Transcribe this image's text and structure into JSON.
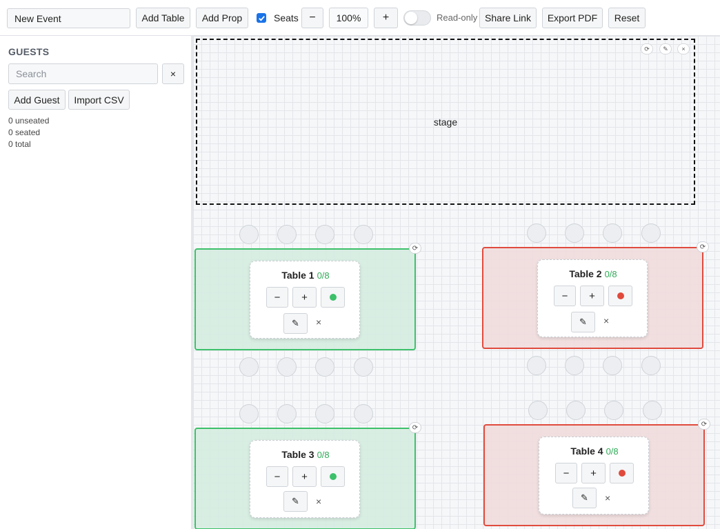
{
  "toolbar": {
    "event_name": "New Event",
    "add_table": "Add Table",
    "add_prop": "Add Prop",
    "seats_label": "Seats",
    "zoom_out": "−",
    "zoom": "100%",
    "zoom_in": "+",
    "readonly_label": "Read-only",
    "share": "Share Link",
    "export": "Export PDF",
    "reset": "Reset",
    "accent_color": "#1a73e8"
  },
  "sidebar": {
    "title": "GUESTS",
    "search_placeholder": "Search",
    "clear": "×",
    "add_guest": "Add Guest",
    "import_csv": "Import CSV",
    "stats": [
      "0 unseated",
      "0 seated",
      "0 total"
    ]
  },
  "canvas": {
    "stage_label": "stage",
    "prop_controls": [
      "⟳",
      "✎",
      "×"
    ],
    "rotate_icon": "⟳",
    "tables": [
      {
        "name": "Table 1",
        "count": "0/8",
        "minus": "−",
        "plus": "+",
        "status": "ok",
        "status_color": "#3cc06a",
        "delete": "×"
      },
      {
        "name": "Table 2",
        "count": "0/8",
        "minus": "−",
        "plus": "+",
        "status": "bad",
        "status_color": "#e04a3c",
        "delete": "×"
      },
      {
        "name": "Table 3",
        "count": "0/8",
        "minus": "−",
        "plus": "+",
        "status": "ok",
        "status_color": "#3cc06a",
        "delete": "×"
      },
      {
        "name": "Table 4",
        "count": "0/8",
        "minus": "−",
        "plus": "+",
        "status": "bad",
        "status_color": "#e04a3c",
        "delete": "×"
      }
    ]
  }
}
